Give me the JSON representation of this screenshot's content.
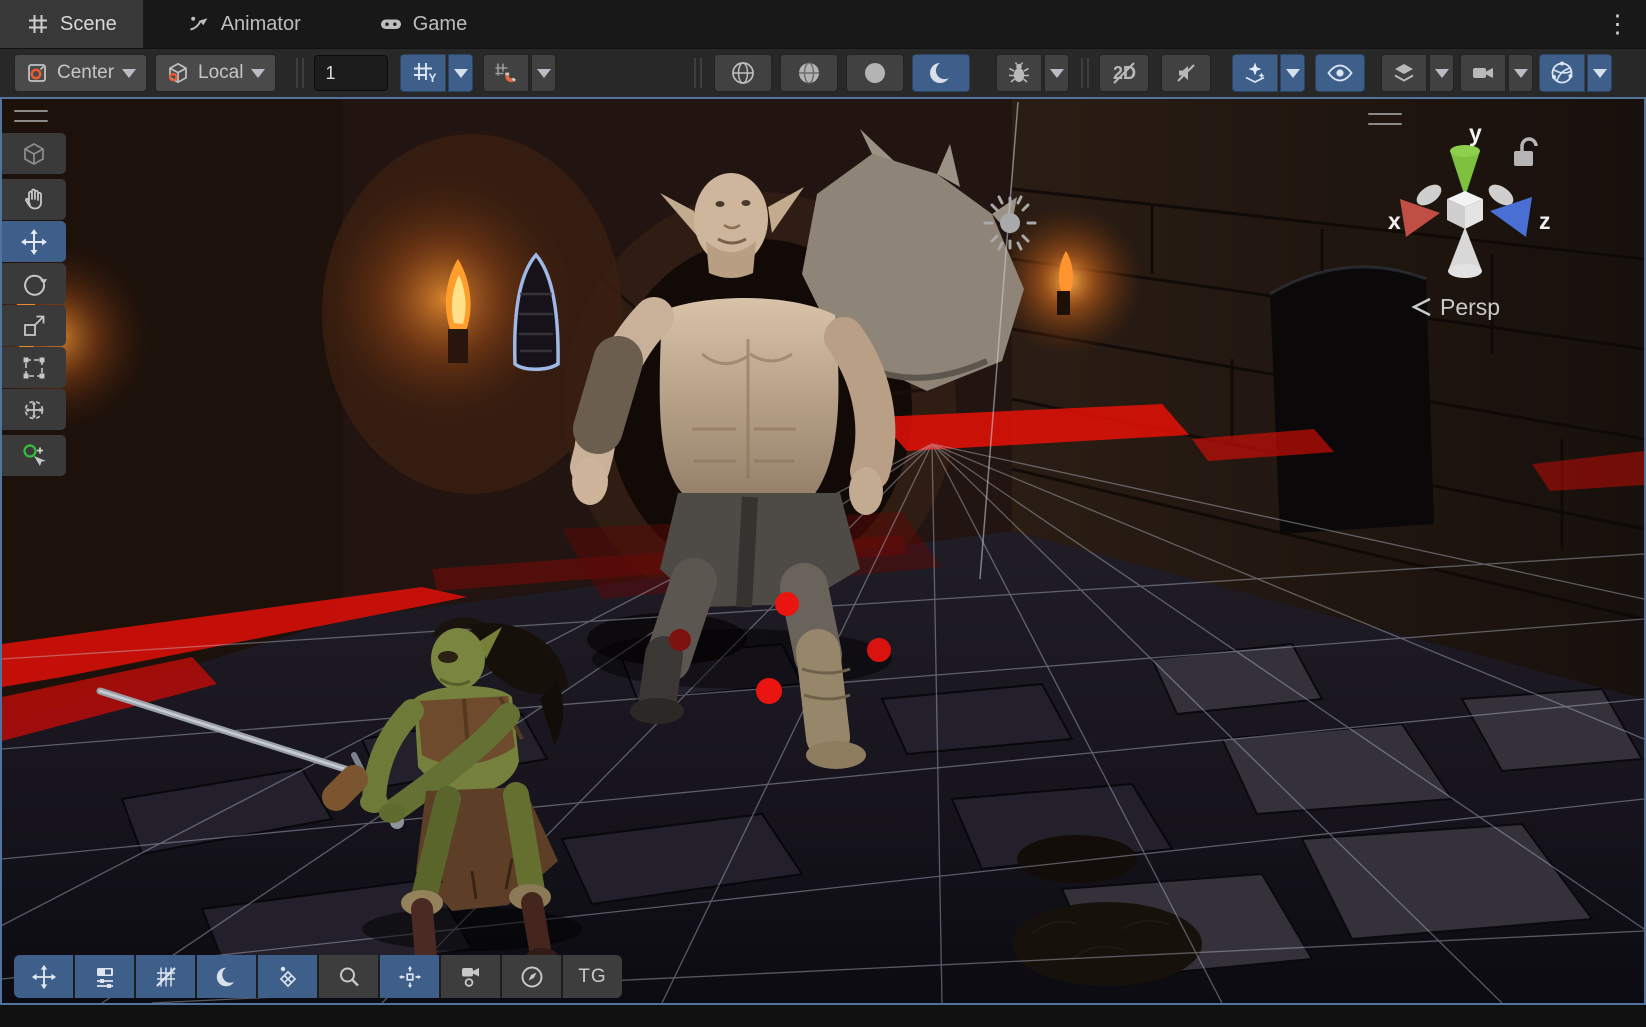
{
  "window": {
    "overflow_menu_glyph": "⋮"
  },
  "tabs": [
    {
      "label": "Scene",
      "icon": "scene-grid-icon",
      "active": true
    },
    {
      "label": "Animator",
      "icon": "animator-icon",
      "active": false
    },
    {
      "label": "Game",
      "icon": "gamepad-icon",
      "active": false
    }
  ],
  "toolbar": {
    "pivot_button": {
      "label": "Center",
      "icon": "pivot-center-icon"
    },
    "orientation_button": {
      "label": "Local",
      "icon": "cube-local-icon"
    },
    "grid_size_value": "1",
    "grid_axis_toggle": {
      "icon": "grid-y-icon",
      "axis_letter": "Y",
      "active": true,
      "has_dropdown": true
    },
    "snap_toggle": {
      "icon": "snap-magnet-icon",
      "active": false,
      "has_dropdown": true
    },
    "draw_modes": [
      {
        "icon": "wireframe-sphere-icon",
        "active": false
      },
      {
        "icon": "shaded-wireframe-sphere-icon",
        "active": false
      },
      {
        "icon": "shaded-sphere-icon",
        "active": false
      },
      {
        "icon": "moon-lighting-icon",
        "active": true
      }
    ],
    "debug_toggle": {
      "icon": "bug-icon",
      "active": false,
      "has_dropdown": true
    },
    "view_toggles": [
      {
        "label": "2D",
        "icon": "2d-toggle-icon",
        "active": false,
        "slashed": true
      },
      {
        "icon": "audio-muted-icon",
        "active": false
      },
      {
        "icon": "effects-icon",
        "active": true,
        "has_dropdown": true
      },
      {
        "icon": "visibility-eye-icon",
        "active": true
      },
      {
        "icon": "layers-icon",
        "active": false,
        "has_dropdown": true
      },
      {
        "icon": "camera-icon",
        "active": false,
        "has_dropdown": true
      },
      {
        "icon": "gizmos-globe-icon",
        "active": true,
        "has_dropdown": true
      }
    ]
  },
  "tools_overlay": {
    "items": [
      {
        "icon": "view-cube-icon",
        "active": false
      },
      {
        "icon": "hand-pan-icon",
        "active": false
      },
      {
        "icon": "move-tool-icon",
        "active": true
      },
      {
        "icon": "rotate-tool-icon",
        "active": false
      },
      {
        "icon": "scale-tool-icon",
        "active": false
      },
      {
        "icon": "rect-tool-icon",
        "active": false
      },
      {
        "icon": "transform-tool-icon",
        "active": false
      },
      {
        "icon": "custom-tool-icon",
        "active": false
      }
    ]
  },
  "scene_view": {
    "orientation_gizmo": {
      "axis_x_label": "x",
      "axis_y_label": "y",
      "axis_z_label": "z",
      "projection_label": "Persp",
      "x_color": "#bf4f45",
      "y_color": "#7ec13e",
      "z_color": "#4a6fd4",
      "locked": false
    },
    "light_gizmo": "sun-icon",
    "selection_outline_color": "#9fb9e6",
    "focus_border_color": "#51749e",
    "waypoint_color": "#ea1510",
    "objects": [
      "large-orc-character",
      "small-orc-character",
      "selected-window",
      "directional-light",
      "path-waypoints"
    ]
  },
  "bottom_toolbar": {
    "buttons": [
      {
        "icon": "move-tool-icon",
        "active": true
      },
      {
        "icon": "mixer-icon",
        "active": true
      },
      {
        "icon": "grid-off-icon",
        "active": true
      },
      {
        "icon": "moon-lighting-icon",
        "active": true
      },
      {
        "icon": "navmesh-diamond-icon",
        "active": true
      },
      {
        "icon": "search-icon",
        "active": false
      },
      {
        "icon": "focus-center-icon",
        "active": true
      },
      {
        "icon": "camera-preview-icon",
        "active": false
      },
      {
        "icon": "compass-icon",
        "active": false
      },
      {
        "label": "TG",
        "active": false
      }
    ]
  },
  "colors": {
    "active_toggle": "#3e5f8a",
    "toolbar_bg": "#282828",
    "tabbar_bg": "#181818",
    "button_bg": "#414141",
    "accent_orange": "#ef5b2e"
  }
}
